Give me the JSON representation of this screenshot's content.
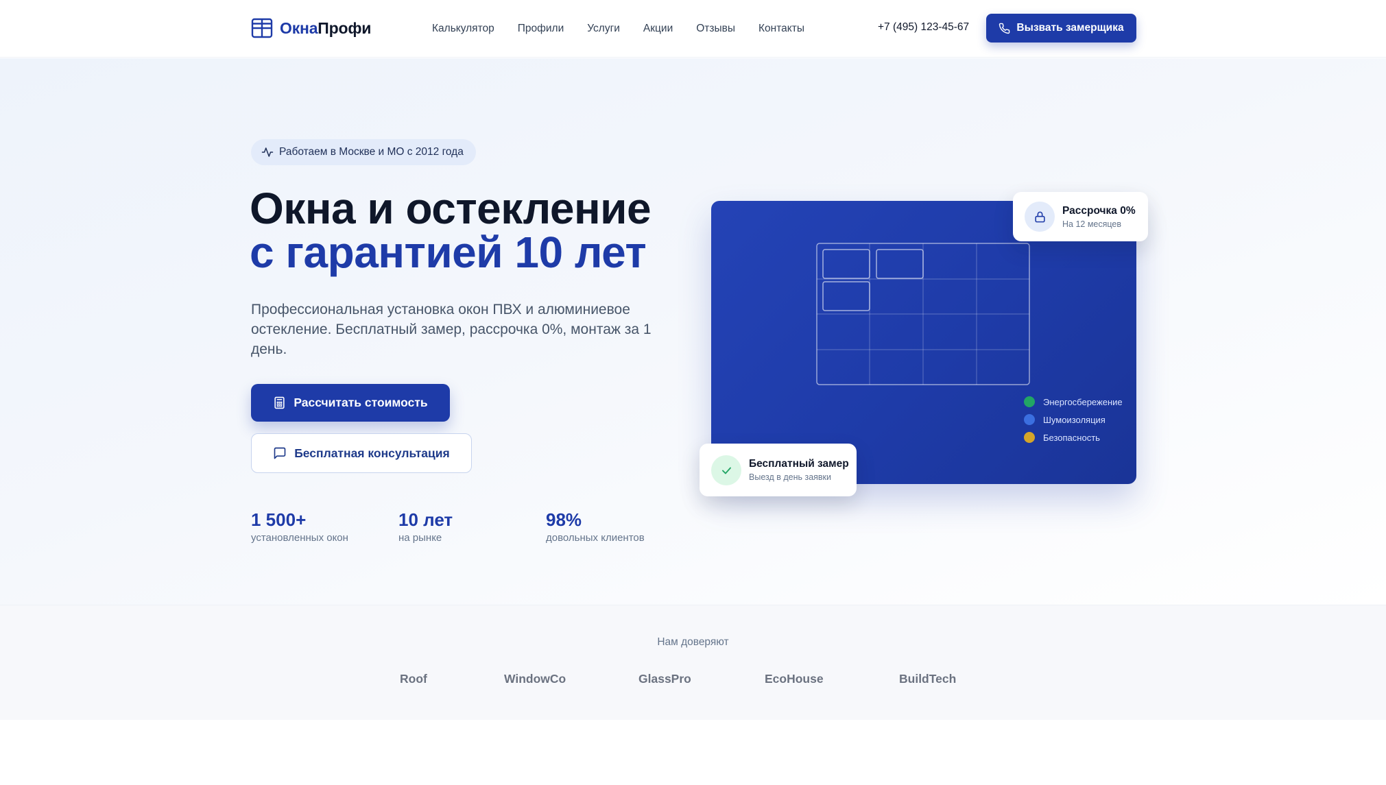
{
  "header": {
    "logo_part1": "Окна",
    "logo_part2": "Профи",
    "nav": [
      "Калькулятор",
      "Профили",
      "Услуги",
      "Акции",
      "Отзывы",
      "Контакты"
    ],
    "phone": "+7 (495) 123-45-67",
    "cta_label": "Вызвать замерщика"
  },
  "hero": {
    "badge": "Работаем в Москве и МО с 2012 года",
    "title_line1": "Окна и остекление",
    "title_line2": "с гарантией 10 лет",
    "lead": "Профессиональная установка окон ПВХ и алюминиевое остекление. Бесплатный замер, рассрочка 0%, монтаж за 1 день.",
    "btn_primary": "Рассчитать стоимость",
    "btn_secondary": "Бесплатная консультация",
    "stats": [
      {
        "value": "1 500+",
        "label": "установленных окон"
      },
      {
        "value": "10 лет",
        "label": "на рынке"
      },
      {
        "value": "98%",
        "label": "довольных клиентов"
      }
    ]
  },
  "card": {
    "legend": [
      {
        "label": "Энергосбережение",
        "color": "#22a565"
      },
      {
        "label": "Шумоизоляция",
        "color": "#3b6fe0"
      },
      {
        "label": "Безопасность",
        "color": "#d4a52a"
      }
    ],
    "float_installment": {
      "title": "Рассрочка 0%",
      "subtitle": "На 12 месяцев",
      "icon": "lock-icon"
    },
    "float_measure": {
      "title": "Бесплатный замер",
      "subtitle": "Выезд в день заявки",
      "icon": "check-icon"
    }
  },
  "trust": {
    "title": "Нам доверяют",
    "brands": [
      "Roof",
      "WindowCo",
      "GlassPro",
      "EcoHouse",
      "BuildTech"
    ]
  },
  "colors": {
    "brand": "#1e3ba8",
    "text": "#0f172a",
    "muted": "#64748b"
  }
}
